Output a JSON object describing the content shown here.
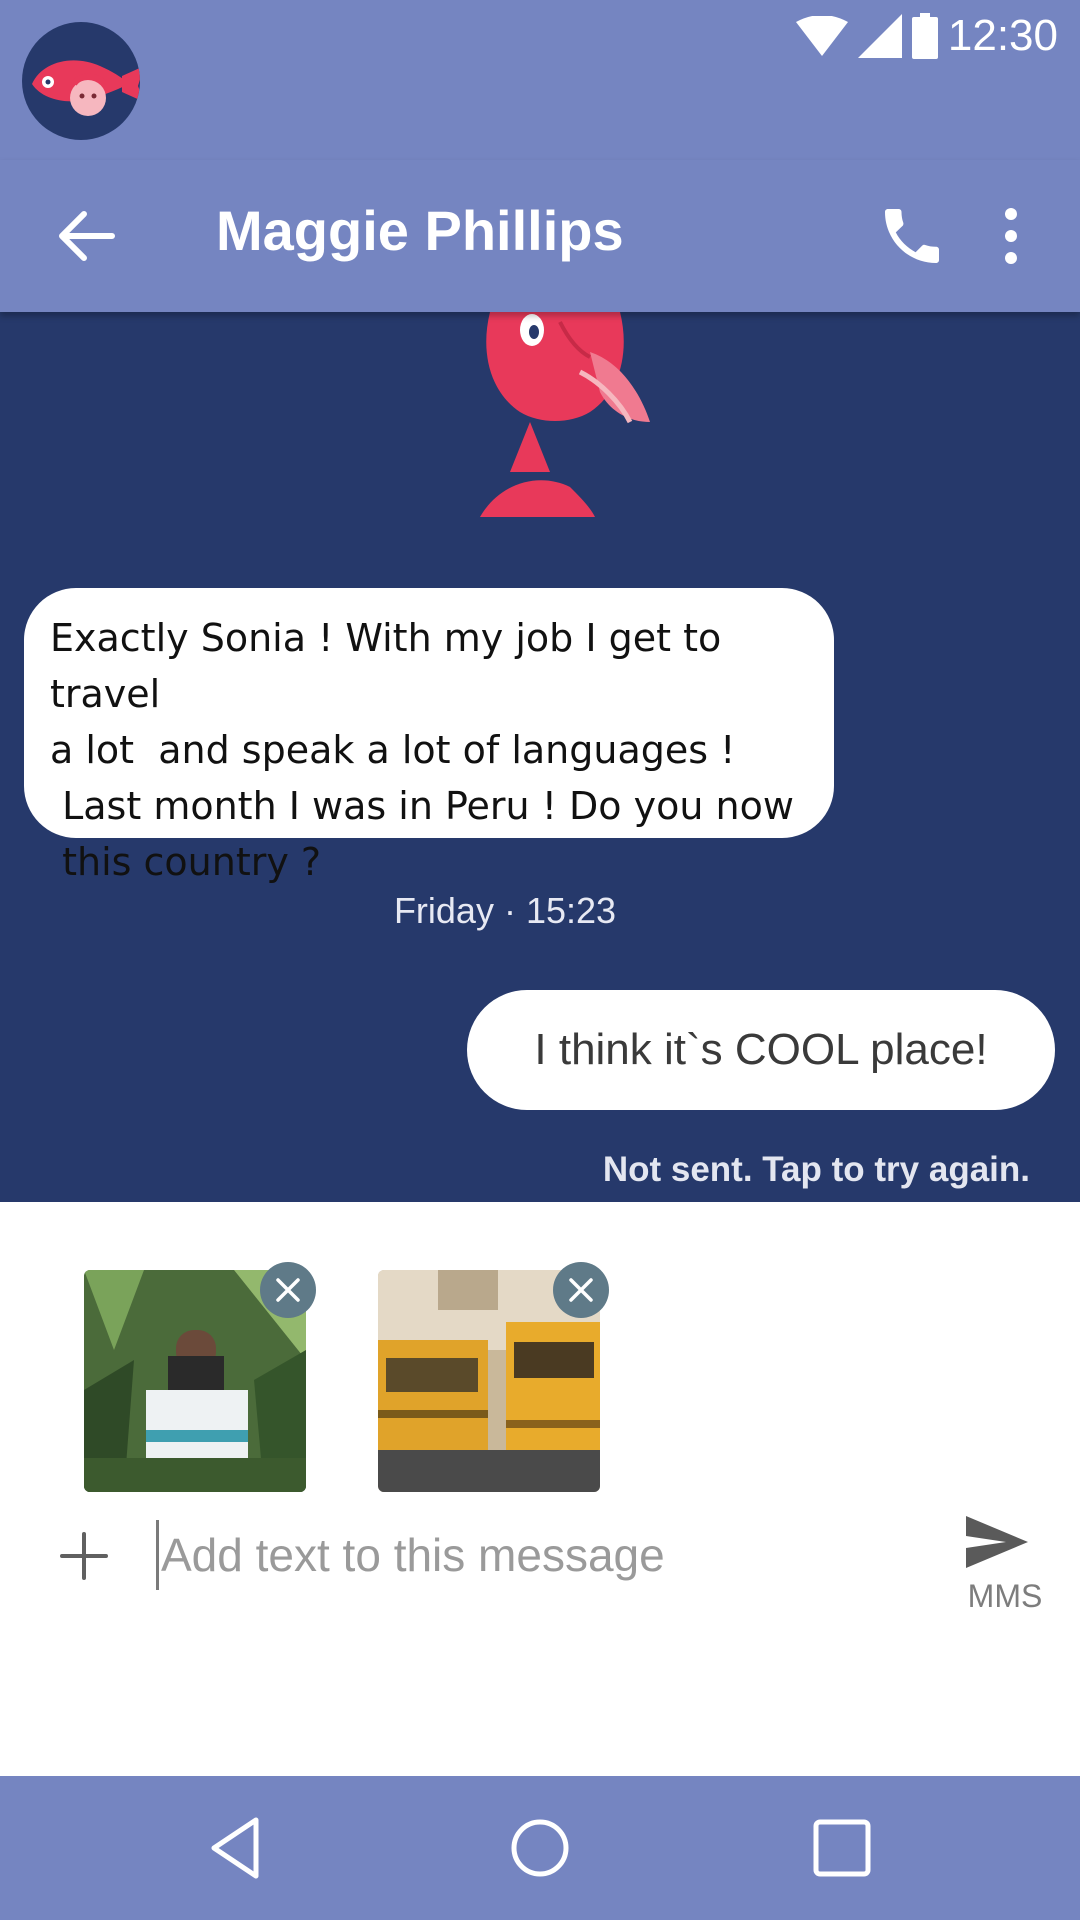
{
  "status_bar": {
    "time": "12:30"
  },
  "header": {
    "contact_name": "Maggie Phillips"
  },
  "conversation": {
    "incoming_message": "Exactly Sonia ! With my job I get to travel\na lot  and speak a lot of languages !\n Last month I was in Peru ! Do you now\n this country ?",
    "timestamp": "Friday · 15:23",
    "outgoing_message": "I think it`s COOL place!",
    "send_status": "Not sent. Tap to try again."
  },
  "compose": {
    "placeholder": "Add text to this message",
    "send_label": "MMS"
  },
  "colors": {
    "primary": "#7585c1",
    "conversation_bg": "#26396b",
    "accent": "#e8395a"
  },
  "icons": [
    "wifi-icon",
    "signal-icon",
    "battery-icon",
    "back-arrow-icon",
    "phone-icon",
    "more-vert-icon",
    "close-icon",
    "plus-icon",
    "send-icon",
    "nav-back-icon",
    "nav-home-icon",
    "nav-recents-icon"
  ]
}
